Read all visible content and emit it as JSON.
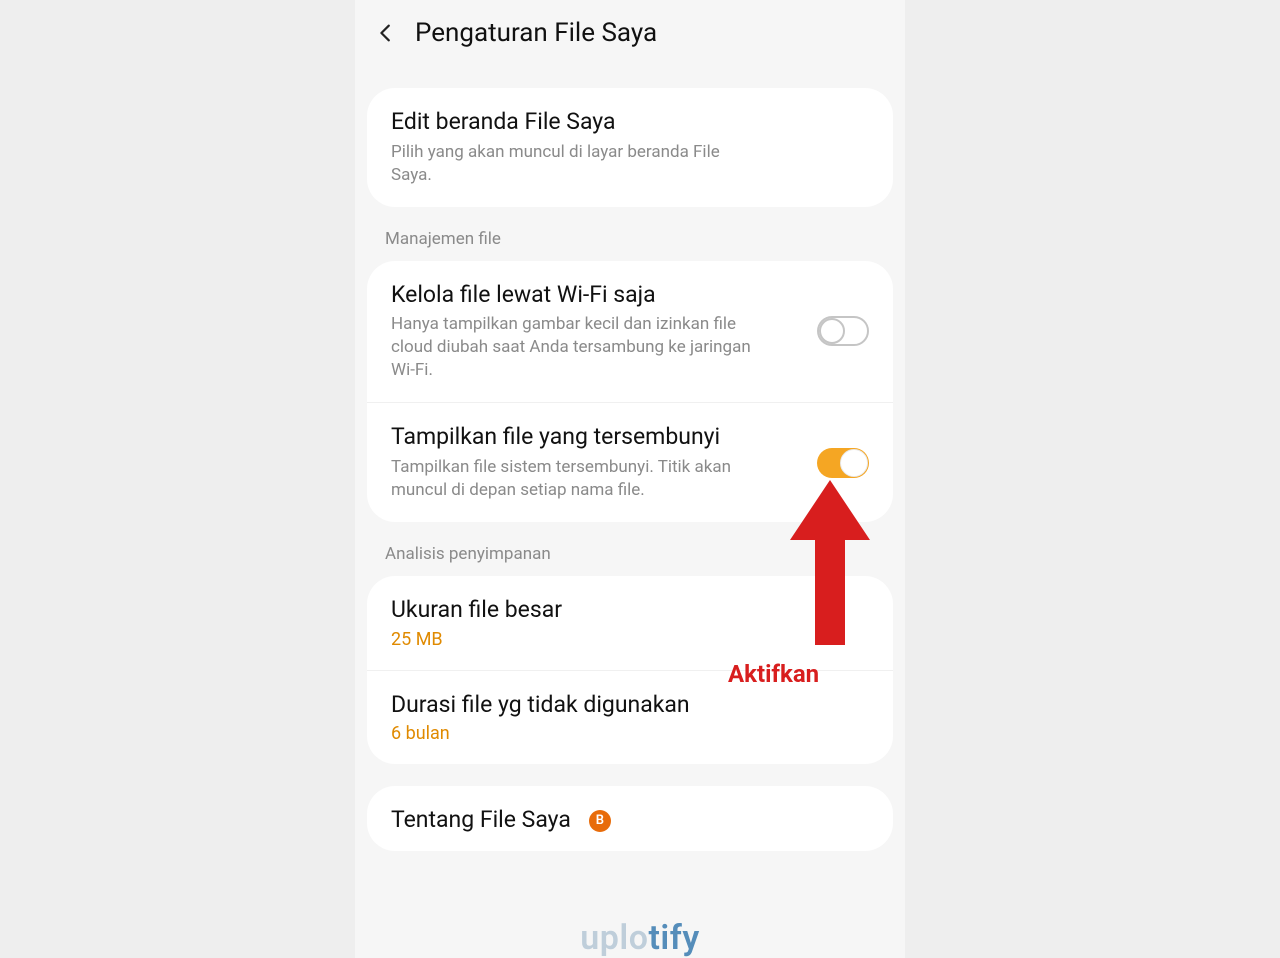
{
  "header": {
    "title": "Pengaturan File Saya"
  },
  "card_edit": {
    "title": "Edit beranda File Saya",
    "subtitle": "Pilih yang akan muncul di layar beranda File Saya."
  },
  "section_management": {
    "label": "Manajemen file"
  },
  "row_wifi": {
    "title": "Kelola file lewat Wi-Fi saja",
    "subtitle": "Hanya tampilkan gambar kecil dan izinkan file cloud diubah saat Anda tersambung ke jaringan Wi-Fi."
  },
  "row_hidden": {
    "title": "Tampilkan file yang tersembunyi",
    "subtitle": "Tampilkan file sistem tersembunyi. Titik akan muncul di depan setiap nama file."
  },
  "section_storage": {
    "label": "Analisis penyimpanan"
  },
  "row_largefile": {
    "title": "Ukuran file besar",
    "value": "25 MB"
  },
  "row_unused": {
    "title": "Durasi file yg tidak digunakan",
    "value": "6 bulan"
  },
  "row_about": {
    "title": "Tentang File Saya",
    "badge": "B"
  },
  "annotation": {
    "label": "Aktifkan"
  },
  "watermark": {
    "part1": "uplo",
    "part2": "tify"
  }
}
